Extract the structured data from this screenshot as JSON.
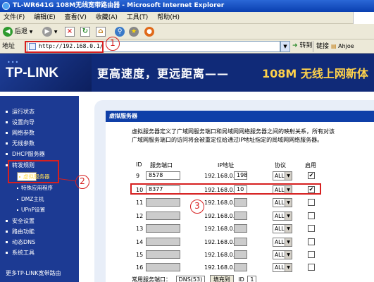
{
  "window": {
    "title": "TL-WR641G 108M无线宽带路由器 - Microsoft Internet Explorer"
  },
  "menu": [
    "文件(F)",
    "编辑(E)",
    "查看(V)",
    "收藏(A)",
    "工具(T)",
    "帮助(H)"
  ],
  "toolbar": {
    "back_label": "后退"
  },
  "address": {
    "label": "地址",
    "url": "http://192.168.0.1/",
    "go_label": "转到",
    "links_label": "链接",
    "link_item": "Ahjoe"
  },
  "banner": {
    "brand": "TP-LINK",
    "slogan": "更高速度，更远距离——",
    "slogan_highlight": "108M 无线上网新体"
  },
  "sidebar": {
    "items": [
      {
        "label": "运行状态"
      },
      {
        "label": "设置向导"
      },
      {
        "label": "网络参数"
      },
      {
        "label": "无线参数"
      },
      {
        "label": "DHCP服务器"
      },
      {
        "label": "转发规则"
      },
      {
        "label": "虚拟服务器"
      },
      {
        "label": "特殊应用程序"
      },
      {
        "label": "DMZ主机"
      },
      {
        "label": "UPnP设置"
      },
      {
        "label": "安全设置"
      },
      {
        "label": "路由功能"
      },
      {
        "label": "动态DNS"
      },
      {
        "label": "系统工具"
      }
    ],
    "help": "更多TP-LINK宽带路由"
  },
  "panel": {
    "title": "虚拟服务器",
    "description": "虚拟服务器定义了广域网服务端口和局域网网络服务器之间的映射关系，所有对该广域网服务端口的访问将会被重定位给通过IP地址指定的局域网网络服务器。",
    "headers": {
      "id": "ID",
      "port": "服务端口",
      "ip": "IP地址",
      "protocol": "协议",
      "enable": "启用"
    },
    "ip_prefix": "192.168.0.",
    "rows": [
      {
        "id": "9",
        "port": "8578",
        "ip": "198",
        "protocol": "ALL",
        "checked": "✔"
      },
      {
        "id": "10",
        "port": "8377",
        "ip": "10",
        "protocol": "ALL",
        "checked": "✔"
      },
      {
        "id": "11",
        "port": "",
        "ip": "",
        "protocol": "ALL",
        "checked": ""
      },
      {
        "id": "12",
        "port": "",
        "ip": "",
        "protocol": "ALL",
        "checked": ""
      },
      {
        "id": "13",
        "port": "",
        "ip": "",
        "protocol": "ALL",
        "checked": ""
      },
      {
        "id": "14",
        "port": "",
        "ip": "",
        "protocol": "ALL",
        "checked": ""
      },
      {
        "id": "15",
        "port": "",
        "ip": "",
        "protocol": "ALL",
        "checked": ""
      },
      {
        "id": "16",
        "port": "",
        "ip": "",
        "protocol": "ALL",
        "checked": ""
      }
    ],
    "bottom": {
      "label": "常用服务端口：",
      "select": "DNS(53)",
      "button": "填充到",
      "id_label": "ID",
      "id_select": "1"
    }
  },
  "annotations": [
    "1",
    "2",
    "3"
  ],
  "colors": {
    "sidebar": "#1c3a93",
    "banner": "#102a78",
    "panel_header": "#0f3fa8",
    "annotation": "#d62020"
  }
}
